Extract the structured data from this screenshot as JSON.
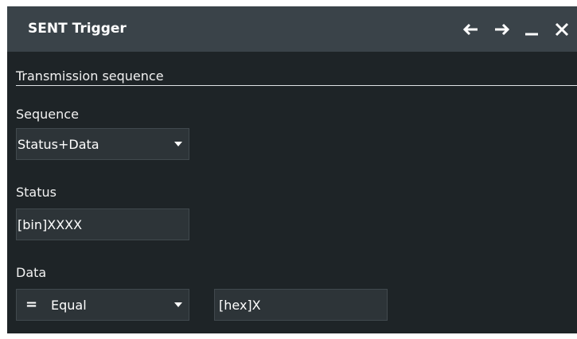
{
  "dialog": {
    "title": "SENT Trigger",
    "controls": {
      "back": "back-arrow",
      "forward": "forward-arrow",
      "minimize": "minimize",
      "close": "close"
    }
  },
  "section": {
    "heading": "Transmission sequence"
  },
  "sequence": {
    "label": "Sequence",
    "selected": "Status+Data"
  },
  "status": {
    "label": "Status",
    "value": "[bin]XXXX"
  },
  "data": {
    "label": "Data",
    "operator_symbol": "=",
    "operator": "Equal",
    "value": "[hex]X"
  },
  "colors": {
    "background": "#1e2427",
    "titlebar": "#3a4349",
    "field": "#2d3438",
    "text": "#f2f2f2",
    "rule": "#dfe3e6"
  }
}
